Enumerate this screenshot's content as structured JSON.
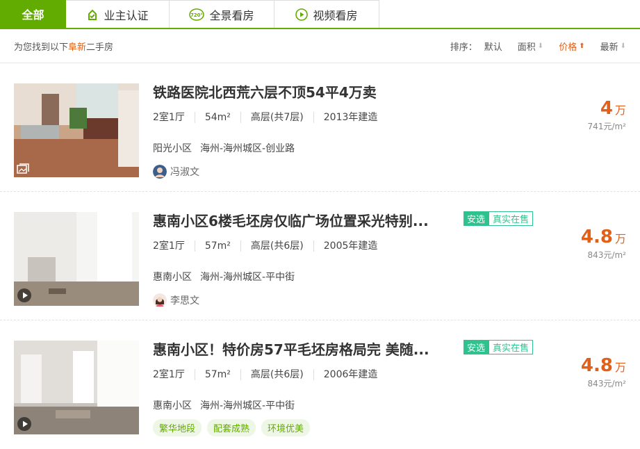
{
  "tabs": [
    {
      "label": "全部",
      "icon": "all"
    },
    {
      "label": "业主认证",
      "icon": "owner-verified-icon"
    },
    {
      "label": "全景看房",
      "icon": "panorama-720-icon",
      "icon_text": "720°"
    },
    {
      "label": "视频看房",
      "icon": "video-play-icon"
    }
  ],
  "summary": {
    "prefix": "为您找到以下",
    "highlight": "阜新",
    "suffix": "二手房"
  },
  "sort": {
    "label": "排序：",
    "options": [
      {
        "label": "默认",
        "active": false,
        "arrow": ""
      },
      {
        "label": "面积",
        "active": false,
        "arrow": "⬇"
      },
      {
        "label": "价格",
        "active": true,
        "arrow": "⬆"
      },
      {
        "label": "最新",
        "active": false,
        "arrow": "⬇"
      }
    ]
  },
  "listings": [
    {
      "title": "铁路医院北西荒六层不顶54平4万卖",
      "tags": [],
      "layout": "2室1厅",
      "area": "54m²",
      "floor": "高层(共7层)",
      "built": "2013年建造",
      "community": "阳光小区",
      "location": "海州-海州城区-创业路",
      "agent": "冯淑文",
      "features": [],
      "price": "4",
      "price_unit": "万",
      "unit_price": "741元/m²",
      "media_icon": "gallery-icon"
    },
    {
      "title": "惠南小区6楼毛坯房仅临广场位置采光特别...",
      "tags": [
        "安选",
        "真实在售"
      ],
      "layout": "2室1厅",
      "area": "57m²",
      "floor": "高层(共6层)",
      "built": "2005年建造",
      "community": "惠南小区",
      "location": "海州-海州城区-平中街",
      "agent": "李思文",
      "features": [],
      "price": "4.8",
      "price_unit": "万",
      "unit_price": "843元/m²",
      "media_icon": "video-play-icon"
    },
    {
      "title": "惠南小区！特价房57平毛坯房格局完 美随...",
      "tags": [
        "安选",
        "真实在售"
      ],
      "layout": "2室1厅",
      "area": "57m²",
      "floor": "高层(共6层)",
      "built": "2006年建造",
      "community": "惠南小区",
      "location": "海州-海州城区-平中街",
      "agent": "",
      "features": [
        "繁华地段",
        "配套成熟",
        "环境优美"
      ],
      "price": "4.8",
      "price_unit": "万",
      "unit_price": "843元/m²",
      "media_icon": "video-play-icon"
    }
  ],
  "colors": {
    "brand": "#62ab00",
    "price": "#e0601a",
    "tag": "#2fc28e"
  }
}
